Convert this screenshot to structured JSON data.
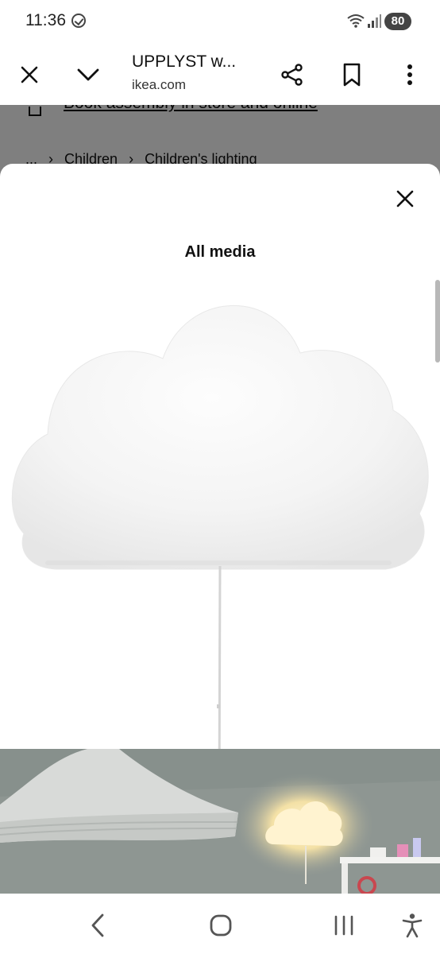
{
  "status_bar": {
    "time": "11:36",
    "battery": "80"
  },
  "browser": {
    "title": "UPPLYST w...",
    "domain": "ikea.com"
  },
  "page": {
    "assembly_text": "Book assembly in store and online",
    "breadcrumb": [
      "...",
      "Children",
      "Children's lighting"
    ]
  },
  "modal": {
    "title": "All media"
  },
  "icons": {
    "close": "close-icon",
    "chevron": "chevron-down-icon",
    "share": "share-icon",
    "bookmark": "bookmark-icon",
    "more": "more-vert-icon",
    "back": "back-icon",
    "home": "home-icon",
    "recents": "recents-icon",
    "accessibility": "accessibility-icon"
  }
}
